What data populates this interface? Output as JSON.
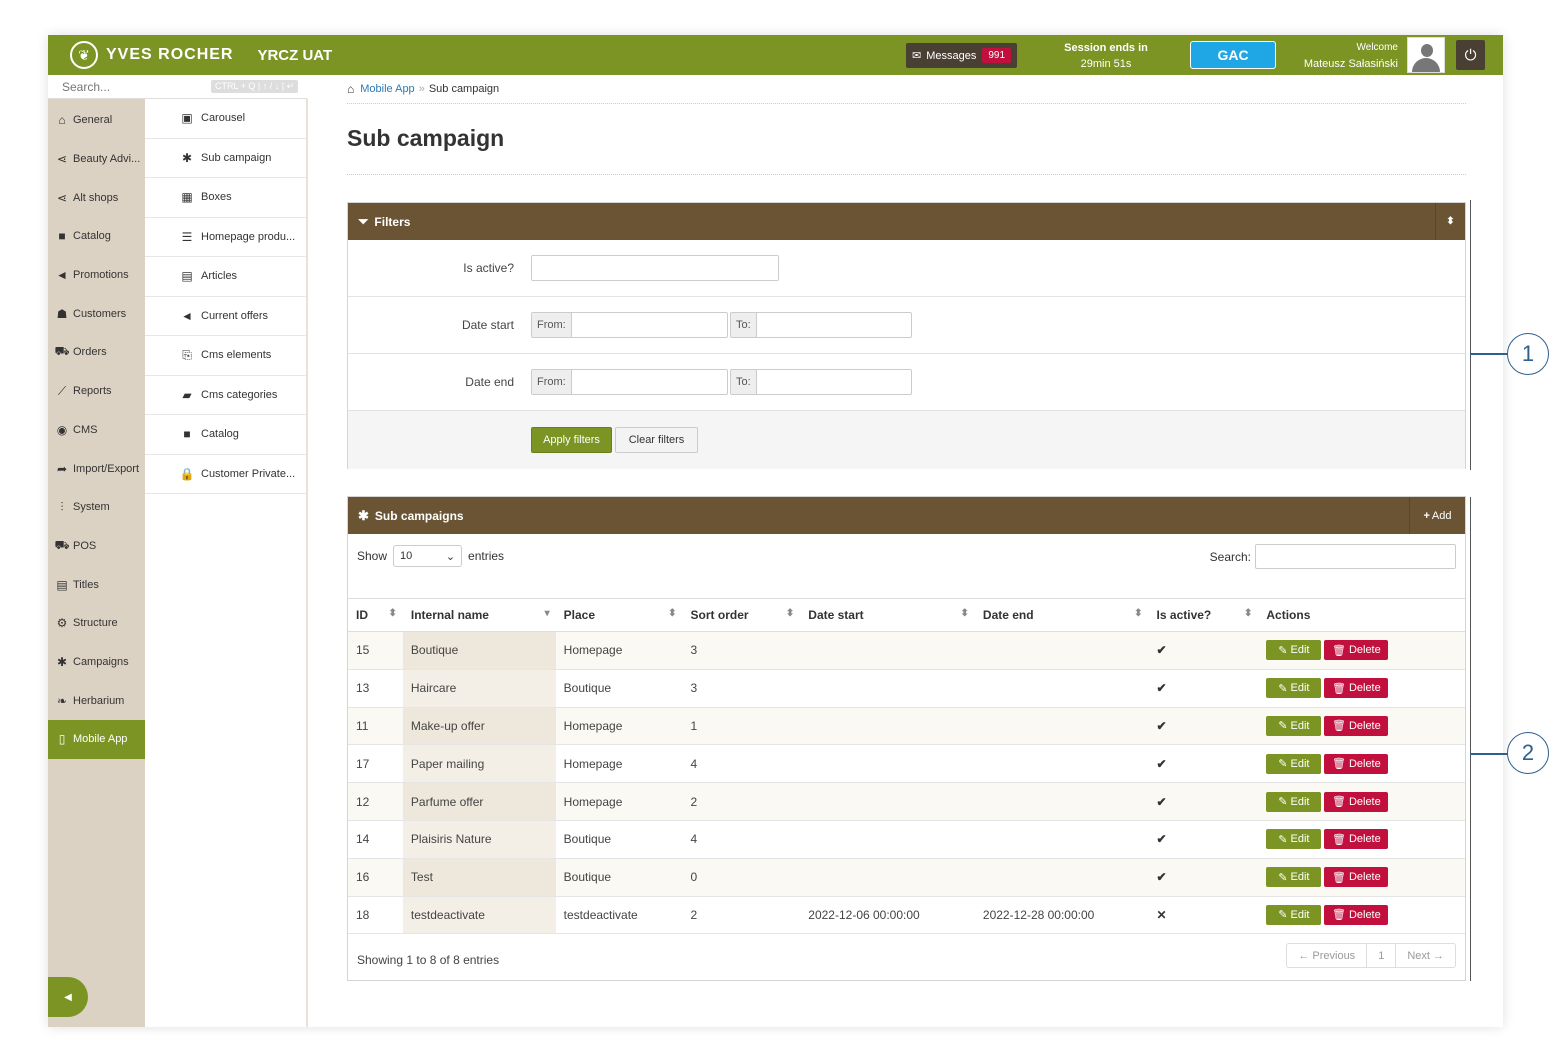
{
  "header": {
    "brand": "YVES ROCHER",
    "env": "YRCZ UAT",
    "messages_label": "Messages",
    "messages_count": "991",
    "session_label": "Session ends in",
    "session_time": "29min 51s",
    "gac": "GAC",
    "welcome": "Welcome",
    "user": "Mateusz Sałasiński"
  },
  "search": {
    "placeholder": "Search...",
    "hint": "CTRL + Q | ↑ / ↓ | ↵"
  },
  "sidebar": {
    "items": [
      {
        "label": "General",
        "icon": "home-icon"
      },
      {
        "label": "Beauty Advi...",
        "icon": "share-icon"
      },
      {
        "label": "Alt shops",
        "icon": "share-icon"
      },
      {
        "label": "Catalog",
        "icon": "folder-icon"
      },
      {
        "label": "Promotions",
        "icon": "megaphone-icon"
      },
      {
        "label": "Customers",
        "icon": "users-icon"
      },
      {
        "label": "Orders",
        "icon": "cart-icon"
      },
      {
        "label": "Reports",
        "icon": "chart-icon"
      },
      {
        "label": "CMS",
        "icon": "globe-icon"
      },
      {
        "label": "Import/Export",
        "icon": "share-arrow-icon"
      },
      {
        "label": "System",
        "icon": "sliders-icon"
      },
      {
        "label": "POS",
        "icon": "cart-icon"
      },
      {
        "label": "Titles",
        "icon": "newspaper-icon"
      },
      {
        "label": "Structure",
        "icon": "gear-icon"
      },
      {
        "label": "Campaigns",
        "icon": "asterisk-icon"
      },
      {
        "label": "Herbarium",
        "icon": "leaf-icon"
      },
      {
        "label": "Mobile App",
        "icon": "mobile-icon"
      }
    ]
  },
  "subnav": {
    "items": [
      {
        "label": "Carousel",
        "icon": "carousel-icon"
      },
      {
        "label": "Sub campaign",
        "icon": "asterisk-icon"
      },
      {
        "label": "Boxes",
        "icon": "grid-icon"
      },
      {
        "label": "Homepage produ...",
        "icon": "list-icon"
      },
      {
        "label": "Articles",
        "icon": "newspaper-icon"
      },
      {
        "label": "Current offers",
        "icon": "megaphone-icon"
      },
      {
        "label": "Cms elements",
        "icon": "code-file-icon"
      },
      {
        "label": "Cms categories",
        "icon": "book-icon"
      },
      {
        "label": "Catalog",
        "icon": "folder-icon"
      },
      {
        "label": "Customer Private...",
        "icon": "lock-icon"
      }
    ]
  },
  "breadcrumb": {
    "link": "Mobile App",
    "current": "Sub campaign"
  },
  "page_title": "Sub campaign",
  "filters": {
    "title": "Filters",
    "is_active_label": "Is active?",
    "date_start_label": "Date start",
    "date_end_label": "Date end",
    "from": "From:",
    "to": "To:",
    "apply": "Apply filters",
    "clear": "Clear filters"
  },
  "table": {
    "title": "Sub campaigns",
    "add": "Add",
    "show": "Show",
    "entries_value": "10",
    "entries": "entries",
    "search_label": "Search:",
    "columns": [
      "ID",
      "Internal name",
      "Place",
      "Sort order",
      "Date start",
      "Date end",
      "Is active?",
      "Actions"
    ],
    "rows": [
      {
        "id": "15",
        "name": "Boutique",
        "place": "Homepage",
        "sort": "3",
        "start": "",
        "end": "",
        "active": "✔"
      },
      {
        "id": "13",
        "name": "Haircare",
        "place": "Boutique",
        "sort": "3",
        "start": "",
        "end": "",
        "active": "✔"
      },
      {
        "id": "11",
        "name": "Make-up offer",
        "place": "Homepage",
        "sort": "1",
        "start": "",
        "end": "",
        "active": "✔"
      },
      {
        "id": "17",
        "name": "Paper mailing",
        "place": "Homepage",
        "sort": "4",
        "start": "",
        "end": "",
        "active": "✔"
      },
      {
        "id": "12",
        "name": "Parfume offer",
        "place": "Homepage",
        "sort": "2",
        "start": "",
        "end": "",
        "active": "✔"
      },
      {
        "id": "14",
        "name": "Plaisiris Nature",
        "place": "Boutique",
        "sort": "4",
        "start": "",
        "end": "",
        "active": "✔"
      },
      {
        "id": "16",
        "name": "Test",
        "place": "Boutique",
        "sort": "0",
        "start": "",
        "end": "",
        "active": "✔"
      },
      {
        "id": "18",
        "name": "testdeactivate",
        "place": "testdeactivate",
        "sort": "2",
        "start": "2022-12-06 00:00:00",
        "end": "2022-12-28 00:00:00",
        "active": "✕"
      }
    ],
    "edit": "Edit",
    "delete": "Delete",
    "info": "Showing 1 to 8 of 8 entries",
    "prev": "← Previous",
    "page": "1",
    "next": "Next →"
  },
  "callouts": [
    "1",
    "2"
  ]
}
